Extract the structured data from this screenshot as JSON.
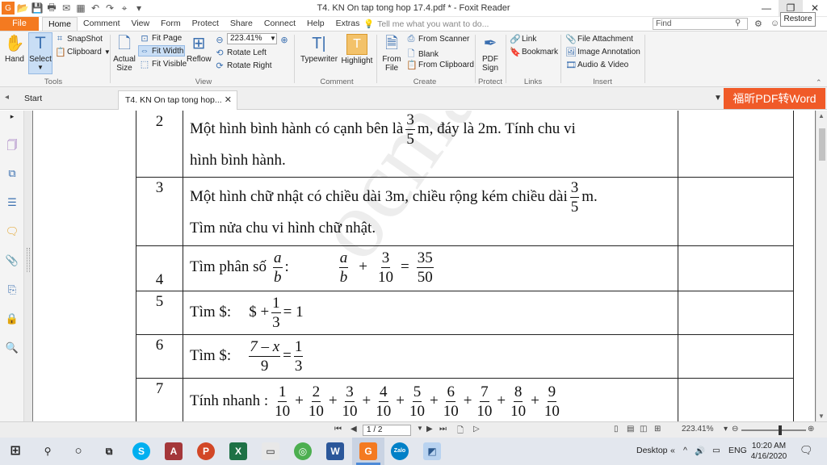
{
  "window": {
    "title": "T4. KN On tap tong hop 17.4.pdf * - Foxit Reader",
    "restore_tooltip": "Restore",
    "minimize_glyph": "—",
    "maximize_glyph": "❐",
    "close_glyph": "✕"
  },
  "menu": {
    "file": "File",
    "tabs": [
      "Home",
      "Comment",
      "View",
      "Form",
      "Protect",
      "Share",
      "Connect",
      "Help",
      "Extras"
    ],
    "tell_me": "Tell me what you want to do...",
    "find_placeholder": "Find"
  },
  "ribbon": {
    "tools": {
      "hand": "Hand",
      "select": "Select",
      "snapshot": "SnapShot",
      "clipboard": "Clipboard",
      "label": "Tools"
    },
    "view": {
      "actual_size_1": "Actual",
      "actual_size_2": "Size",
      "fit_page": "Fit Page",
      "fit_width": "Fit Width",
      "fit_visible": "Fit Visible",
      "reflow": "Reflow",
      "zoom": "223.41%",
      "rotate_left": "Rotate Left",
      "rotate_right": "Rotate Right",
      "label": "View"
    },
    "comment": {
      "typewriter": "Typewriter",
      "highlight": "Highlight",
      "label": "Comment"
    },
    "create": {
      "from_file_1": "From",
      "from_file_2": "File",
      "from_scanner": "From Scanner",
      "blank": "Blank",
      "from_clipboard": "From Clipboard",
      "label": "Create"
    },
    "protect": {
      "pdf_sign_1": "PDF",
      "pdf_sign_2": "Sign",
      "label": "Protect"
    },
    "links": {
      "link": "Link",
      "bookmark": "Bookmark",
      "label": "Links"
    },
    "insert": {
      "file_attachment": "File Attachment",
      "image_annotation": "Image Annotation",
      "audio_video": "Audio & Video",
      "label": "Insert"
    }
  },
  "tabs": {
    "start": "Start",
    "doc": "T4. KN On tap tong hop...",
    "banner": "福昕PDF转Word"
  },
  "document": {
    "watermark": "ocmath.com",
    "rows": [
      {
        "num": "2",
        "line1_a": "Một hình bình hành có cạnh bên là",
        "f1_n": "3",
        "f1_d": "5",
        "line1_b": "m, đáy là 2m. Tính chu vi",
        "line2": "hình bình hành."
      },
      {
        "num": "3",
        "line1_a": "Một hình chữ nhật có chiều dài 3m, chiều rộng kém chiều dài",
        "f1_n": "3",
        "f1_d": "5",
        "line1_b": "m.",
        "line2": "Tìm nửa chu vi hình chữ nhật."
      },
      {
        "num": "4",
        "text": "Tìm phân số",
        "f1_n": "a",
        "f1_d": "b",
        "colon": ":",
        "f2_n": "a",
        "f2_d": "b",
        "plus": "+",
        "f3_n": "3",
        "f3_d": "10",
        "eq": "=",
        "f4_n": "35",
        "f4_d": "50"
      },
      {
        "num": "5",
        "text": "Tìm $:",
        "expr_a": "$ +",
        "f1_n": "1",
        "f1_d": "3",
        "expr_b": "= 1"
      },
      {
        "num": "6",
        "text": "Tìm $:",
        "f1_n": "7 – x",
        "f1_d": "9",
        "eq": "=",
        "f2_n": "1",
        "f2_d": "3"
      },
      {
        "num": "7",
        "text": "Tính nhanh :",
        "fracs": [
          {
            "n": "1",
            "d": "10"
          },
          {
            "n": "2",
            "d": "10"
          },
          {
            "n": "3",
            "d": "10"
          },
          {
            "n": "4",
            "d": "10"
          },
          {
            "n": "5",
            "d": "10"
          },
          {
            "n": "6",
            "d": "10"
          },
          {
            "n": "7",
            "d": "10"
          },
          {
            "n": "8",
            "d": "10"
          },
          {
            "n": "9",
            "d": "10"
          }
        ]
      }
    ]
  },
  "status": {
    "page": "1 / 2",
    "zoom": "223.41%"
  },
  "taskbar": {
    "desktop": "Desktop",
    "lang": "ENG",
    "time": "10:20 AM",
    "date": "4/16/2020"
  },
  "colors": {
    "file_tab": "#f47a20",
    "banner": "#f05a28",
    "accent_blue": "#3a6fb0"
  }
}
